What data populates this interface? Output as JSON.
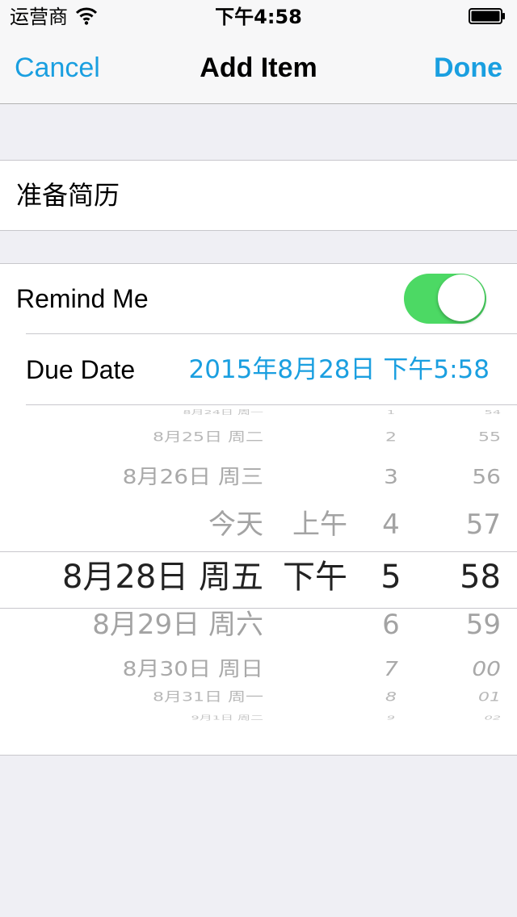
{
  "status": {
    "carrier": "运营商",
    "time": "下午4:58"
  },
  "nav": {
    "cancel": "Cancel",
    "title": "Add Item",
    "done": "Done"
  },
  "item": {
    "name": "准备简历"
  },
  "remind": {
    "label": "Remind Me",
    "enabled": true,
    "toggle_color": "#4cd964"
  },
  "due": {
    "label": "Due Date",
    "value": "2015年8月28日 下午5:58"
  },
  "accent_color": "#1a9fe0",
  "picker": {
    "dates": [
      "8月24日 周一",
      "8月25日 周二",
      "8月26日 周三",
      "今天",
      "8月28日 周五",
      "8月29日 周六",
      "8月30日 周日",
      "8月31日 周一",
      "9月1日 周二"
    ],
    "ampm": [
      "上午",
      "下午"
    ],
    "hours": [
      "1",
      "2",
      "3",
      "4",
      "5",
      "6",
      "7",
      "8",
      "9"
    ],
    "minutes": [
      "54",
      "55",
      "56",
      "57",
      "58",
      "59",
      "00",
      "01",
      "02"
    ]
  }
}
